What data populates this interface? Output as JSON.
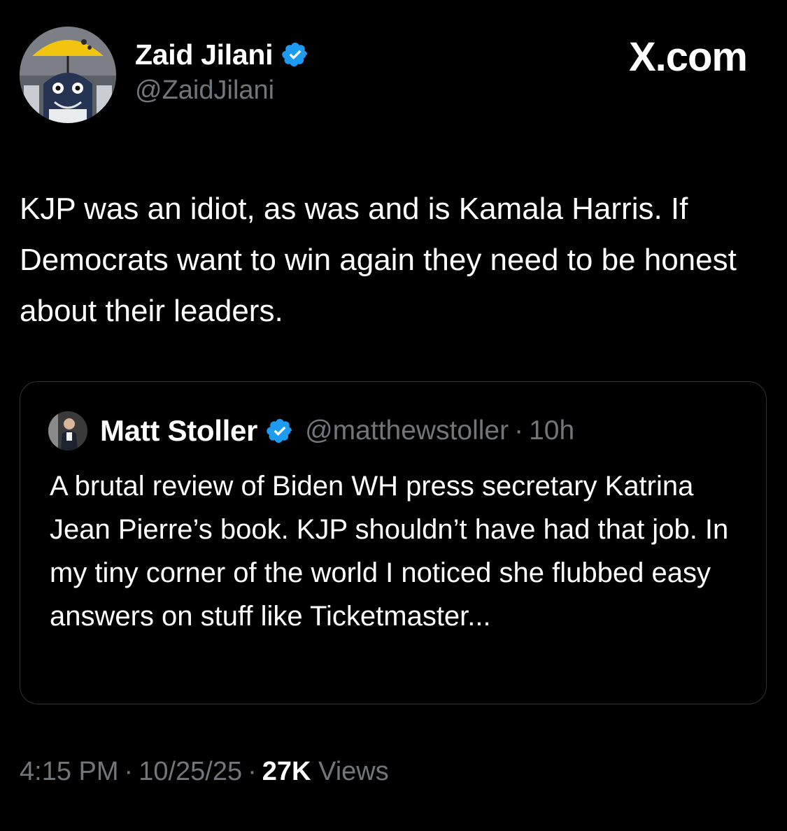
{
  "author": {
    "display_name": "Zaid Jilani",
    "handle": "@ZaidJilani",
    "avatar_icon": "umbrella-creature-avatar",
    "verified_color": "#1d9bf0"
  },
  "brand": {
    "label": "X.com"
  },
  "tweet": {
    "text": "KJP was an idiot, as was and is Kamala Harris. If Democrats want to win again they need to be honest about their leaders."
  },
  "quote": {
    "display_name": "Matt Stoller",
    "handle": "@matthewstoller",
    "separator": "·",
    "time": "10h",
    "text": "A brutal review of Biden WH press secretary Katrina Jean Pierre’s book. KJP shouldn’t have had that job. In my tiny corner of the world I noticed she flubbed easy answers on stuff like Ticketmaster..."
  },
  "footer": {
    "time": "4:15 PM",
    "date": "10/25/25",
    "separator": "·",
    "views_count": "27K",
    "views_label": "Views"
  },
  "colors": {
    "background": "#000000",
    "text": "#ffffff",
    "muted": "#71767b",
    "border": "#2f3336",
    "verified": "#1d9bf0"
  }
}
